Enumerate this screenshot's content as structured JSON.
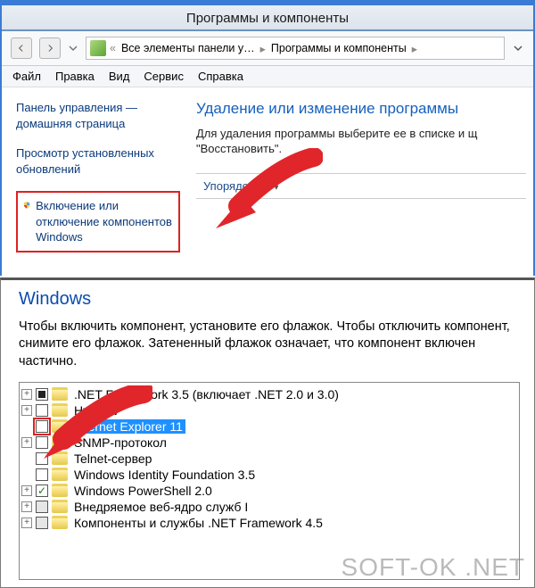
{
  "top": {
    "window_title": "Программы и компоненты",
    "breadcrumb": {
      "segment1": "Все элементы панели у…",
      "segment2": "Программы и компоненты"
    },
    "menu": {
      "file": "Файл",
      "edit": "Правка",
      "view": "Вид",
      "tools": "Сервис",
      "help": "Справка"
    },
    "sidebar": {
      "home": "Панель управления — домашняя страница",
      "updates": "Просмотр установленных обновлений",
      "features": "Включение или отключение компонентов Windows"
    },
    "main": {
      "heading": "Удаление или изменение программы",
      "instr_line1": "Для удаления программы выберите ее в списке и щ",
      "instr_line2": "\"Восстановить\".",
      "sort_label": "Упорядочить"
    }
  },
  "features": {
    "title": "Windows",
    "desc": "Чтобы включить компонент, установите его флажок. Чтобы отключить компонент, снимите его флажок. Затененный флажок означает, что компонент включен частично.",
    "items": [
      {
        "expander": "+",
        "check": "filled",
        "label": ".NET Framework 3.5 (включает .NET 2.0 и 3.0)"
      },
      {
        "expander": "+",
        "check": "empty",
        "label": "Hyper-V"
      },
      {
        "expander": "",
        "check": "empty",
        "label": "Internet Explorer 11",
        "selected": true,
        "highlight": true
      },
      {
        "expander": "+",
        "check": "empty",
        "label": "SNMP-протокол"
      },
      {
        "expander": "",
        "check": "empty",
        "label": "Telnet-сервер"
      },
      {
        "expander": "",
        "check": "empty",
        "label": "Windows Identity Foundation 3.5"
      },
      {
        "expander": "+",
        "check": "checked",
        "label": "Windows PowerShell 2.0"
      },
      {
        "expander": "+",
        "check": "grey",
        "label": "Внедряемое веб-ядро служб I"
      },
      {
        "expander": "+",
        "check": "grey",
        "label": "Компоненты и службы .NET Framework 4.5"
      }
    ]
  },
  "watermark": "SOFT-OK .NET"
}
